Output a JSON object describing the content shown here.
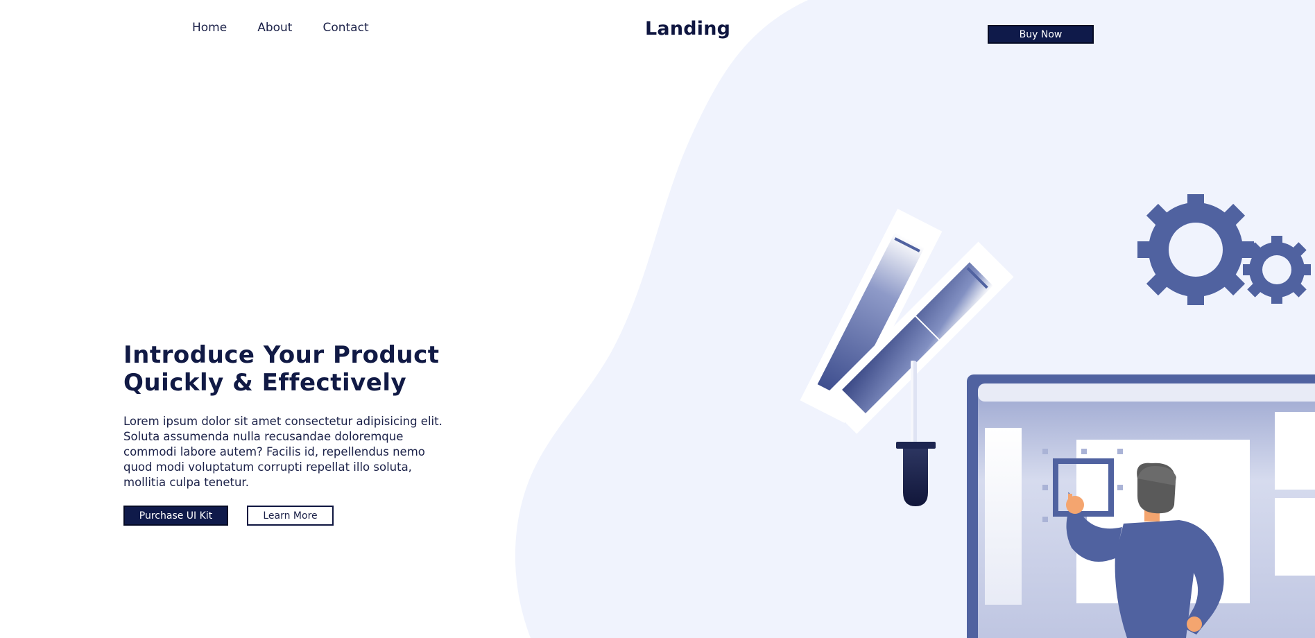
{
  "nav": {
    "items": [
      {
        "label": "Home"
      },
      {
        "label": "About"
      },
      {
        "label": "Contact"
      }
    ]
  },
  "brand": {
    "logo": "Landing"
  },
  "header": {
    "buy_label": "Buy Now"
  },
  "hero": {
    "title_line1": "Introduce Your Product",
    "title_line2": "Quickly & Effectively",
    "description": "Lorem ipsum dolor sit amet consectetur adipisicing elit. Soluta assumenda nulla recusandae doloremque commodi labore autem? Facilis id, repellendus nemo quod modi voluptatum corrupti repellat illo soluta, mollitia culpa tenetur.",
    "primary_cta": "Purchase UI Kit",
    "secondary_cta": "Learn More"
  },
  "theme": {
    "navy": "#0f1a4a",
    "accent_blue": "#5062a0",
    "blob_bg": "#f0f3fd",
    "skin": "#f4a56f"
  },
  "illustration": {
    "icons": [
      "gear-icon",
      "color-swatch-icon",
      "eyedropper-icon",
      "monitor-icon",
      "designer-person-icon"
    ]
  }
}
